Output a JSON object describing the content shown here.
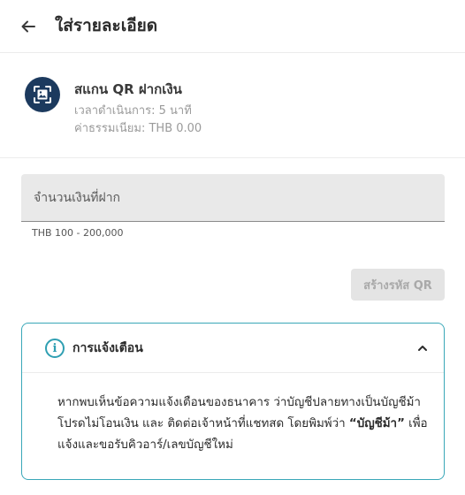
{
  "header": {
    "title": "ใส่รายละเอียด",
    "back_icon": "arrow-left-icon"
  },
  "method": {
    "icon": "qr-scan-icon",
    "icon_color": "#1c3a5e",
    "name": "สแกน QR ฝากเงิน",
    "processing_time": "เวลาดำเนินการ: 5 นาที",
    "fee": "ค่าธรรมเนียม: THB 0.00"
  },
  "amount": {
    "placeholder": "จำนวนเงินที่ฝาก",
    "value": "",
    "hint": "THB 100 - 200,000"
  },
  "create_qr_button": {
    "label": "สร้างรหัส QR",
    "enabled": false
  },
  "notice": {
    "title": "การแจ้งเตือน",
    "icon": "info-icon",
    "expanded": true,
    "accent_color": "#39a7b8",
    "body_part1": "หากพบเห็นข้อความแจ้งเตือนของธนาคาร ว่าบัญชีปลายทางเป็นบัญชีม้า โปรดไม่โอนเงิน และ ติดต่อเจ้าหน้าที่แชทสด โดยพิมพ์ว่า ",
    "body_bold": "“บัญชีม้า”",
    "body_part2": " เพื่อแจ้งและขอรับคิวอาร์/เลขบัญชีใหม่"
  }
}
